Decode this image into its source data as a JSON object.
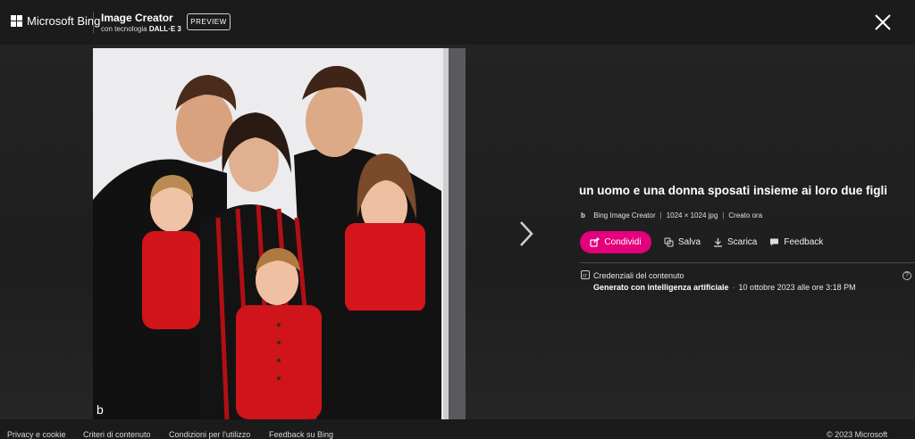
{
  "header": {
    "brand": "Microsoft Bing",
    "product_title": "Image Creator",
    "product_sub_prefix": "con tecnologia",
    "product_sub_tech": "DALL·E 3",
    "preview_label": "PREVIEW"
  },
  "details": {
    "prompt": "un uomo e una donna sposati insieme ai loro due figli",
    "source": "Bing Image Creator",
    "dimensions": "1024 × 1024 jpg",
    "created": "Creato ora"
  },
  "actions": {
    "share": "Condividi",
    "save": "Salva",
    "download": "Scarica",
    "feedback": "Feedback"
  },
  "credentials": {
    "title": "Credenziali del contenuto",
    "generated": "Generato con intelligenza artificiale",
    "date": "10 ottobre 2023 alle ore 3:18 PM"
  },
  "footer": {
    "links": [
      "Privacy e cookie",
      "Criteri di contenuto",
      "Condizioni per l'utilizzo",
      "Feedback su Bing"
    ],
    "copyright": "© 2023 Microsoft"
  },
  "colors": {
    "accent": "#e3007d",
    "background": "#1f1f1f"
  },
  "icons": {
    "close": "close-icon",
    "next": "chevron-right-icon",
    "share": "share-icon",
    "save": "collection-add-icon",
    "download": "download-icon",
    "feedback": "comment-icon",
    "credentials": "content-credentials-icon",
    "help": "help-icon"
  }
}
